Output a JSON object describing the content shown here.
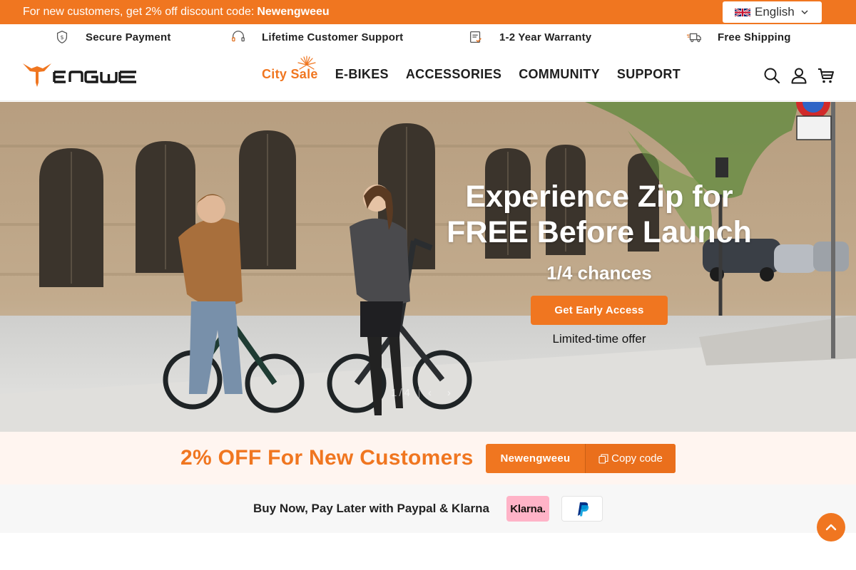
{
  "announcement": {
    "text": "For new customers, get 2% off discount code:",
    "code": "Newengweeu",
    "language": "English",
    "language_flag": "uk-flag-icon"
  },
  "benefits": [
    {
      "icon": "shield-dollar-icon",
      "label": "Secure Payment"
    },
    {
      "icon": "headset-icon",
      "label": "Lifetime Customer Support"
    },
    {
      "icon": "document-check-icon",
      "label": "1-2 Year Warranty"
    },
    {
      "icon": "truck-icon",
      "label": "Free Shipping"
    }
  ],
  "header": {
    "logo_text": "ENGWE",
    "nav": [
      {
        "label": "City Sale",
        "highlight": true
      },
      {
        "label": "E-BIKES"
      },
      {
        "label": "ACCESSORIES"
      },
      {
        "label": "COMMUNITY"
      },
      {
        "label": "SUPPORT"
      }
    ],
    "icons": [
      "search-icon",
      "account-icon",
      "cart-icon"
    ]
  },
  "hero": {
    "title_line1": "Experience Zip for",
    "title_line2": "FREE Before Launch",
    "subtitle": "1/4 chances",
    "cta_label": "Get Early Access",
    "note": "Limited-time offer",
    "pager_current": "1",
    "pager_total": "4"
  },
  "discount": {
    "headline": "2% OFF For New Customers",
    "code": "Newengweeu",
    "copy_label": "Copy code"
  },
  "paylater": {
    "text": "Buy Now, Pay Later with Paypal & Klarna",
    "klarna_label": "Klarna."
  },
  "colors": {
    "brand": "#f07620",
    "discount_bg": "#fff5f0",
    "klarna_pink": "#ffb3c7"
  }
}
